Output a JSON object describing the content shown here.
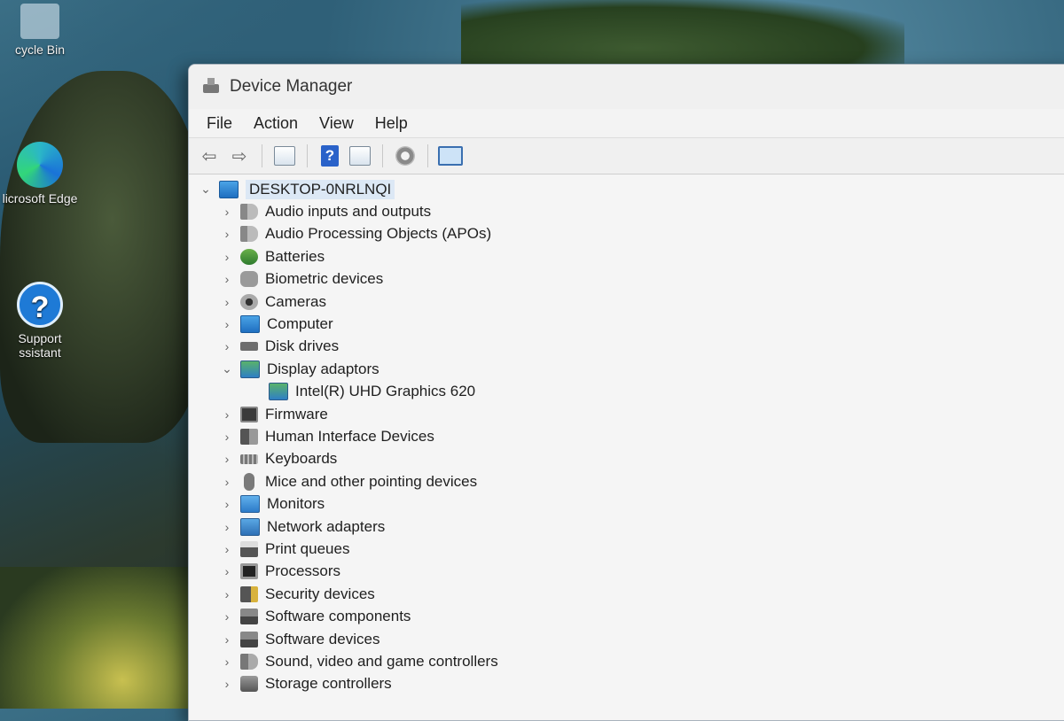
{
  "desktop": {
    "icons": [
      {
        "label": "cycle Bin"
      },
      {
        "label": "licrosoft Edge"
      },
      {
        "label": "Support ssistant"
      }
    ]
  },
  "window": {
    "title": "Device Manager"
  },
  "menu": [
    "File",
    "Action",
    "View",
    "Help"
  ],
  "toolbar": {
    "buttons": [
      "back-arrow-icon",
      "forward-arrow-icon",
      "properties-icon",
      "help-icon",
      "update-driver-icon",
      "scan-hardware-icon",
      "monitor-icon"
    ]
  },
  "tree": {
    "root": "DESKTOP-0NRLNQI",
    "categories": [
      {
        "label": "Audio inputs and outputs",
        "icon": "speaker-icon"
      },
      {
        "label": "Audio Processing Objects (APOs)",
        "icon": "speaker-icon"
      },
      {
        "label": "Batteries",
        "icon": "battery-icon"
      },
      {
        "label": "Biometric devices",
        "icon": "biometric-icon"
      },
      {
        "label": "Cameras",
        "icon": "camera-icon"
      },
      {
        "label": "Computer",
        "icon": "computer-icon"
      },
      {
        "label": "Disk drives",
        "icon": "disk-drive-icon"
      },
      {
        "label": "Display adaptors",
        "icon": "display-adapter-icon",
        "expanded": true,
        "children": [
          {
            "label": "Intel(R) UHD Graphics 620",
            "icon": "display-adapter-icon"
          }
        ]
      },
      {
        "label": "Firmware",
        "icon": "firmware-icon"
      },
      {
        "label": "Human Interface Devices",
        "icon": "hid-icon"
      },
      {
        "label": "Keyboards",
        "icon": "keyboard-icon"
      },
      {
        "label": "Mice and other pointing devices",
        "icon": "mouse-icon"
      },
      {
        "label": "Monitors",
        "icon": "monitor-icon"
      },
      {
        "label": "Network adapters",
        "icon": "network-adapter-icon"
      },
      {
        "label": "Print queues",
        "icon": "printer-icon"
      },
      {
        "label": "Processors",
        "icon": "processor-icon"
      },
      {
        "label": "Security devices",
        "icon": "security-device-icon"
      },
      {
        "label": "Software components",
        "icon": "software-component-icon"
      },
      {
        "label": "Software devices",
        "icon": "software-device-icon"
      },
      {
        "label": "Sound, video and game controllers",
        "icon": "sound-icon"
      },
      {
        "label": "Storage controllers",
        "icon": "storage-controller-icon"
      }
    ]
  }
}
